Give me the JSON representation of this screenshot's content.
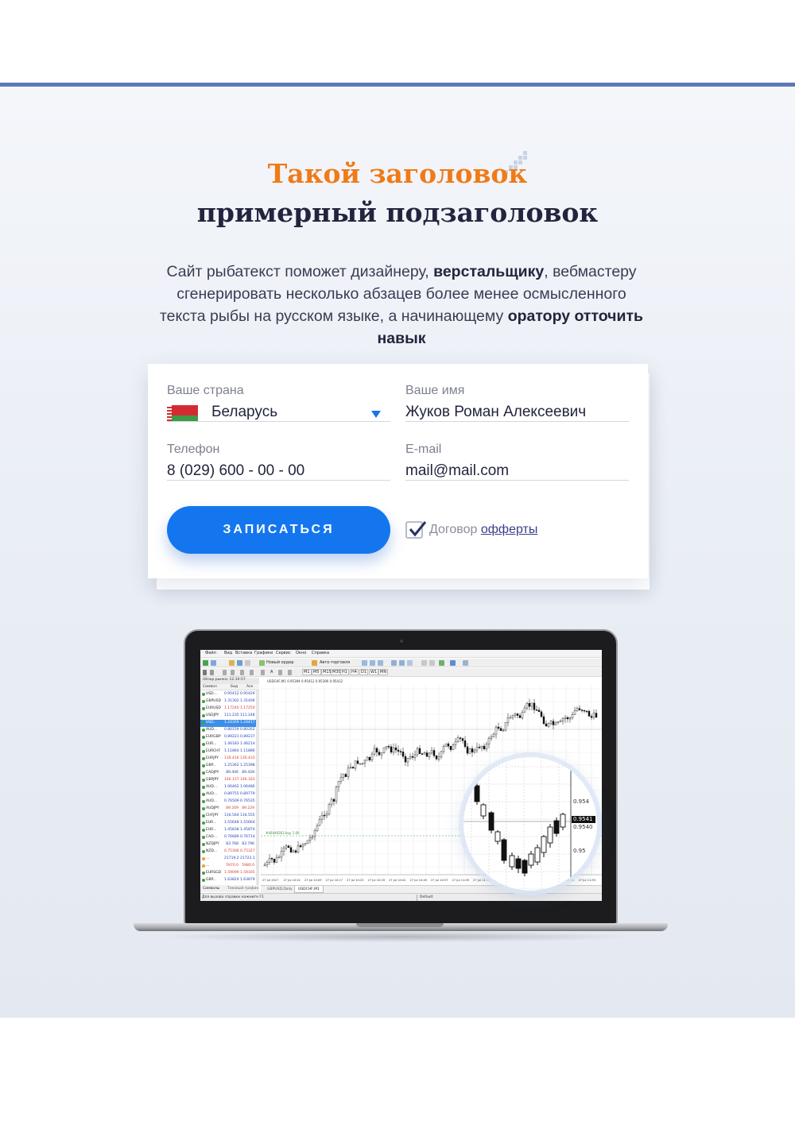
{
  "colors": {
    "accent": "#1476ee",
    "title_orange": "#f07a18",
    "title_dark": "#22253d",
    "top_line": "#5a78b4"
  },
  "hero": {
    "title": "Такой заголовок",
    "subtitle": "примерный подзаголовок",
    "lead_1": "Сайт рыбатекст поможет дизайнеру, ",
    "lead_b1": "верстальщику",
    "lead_2": ", вебмастеру сгенерировать несколько абзацев более менее осмысленного текста рыбы на русском языке, а начинающему ",
    "lead_b2": "оратору отточить навык"
  },
  "form": {
    "country_label": "Ваше страна",
    "country_value": "Беларусь",
    "country_flag": "belarus-flag",
    "name_label": "Ваше имя",
    "name_value": "Жуков Роман Алексеевич",
    "phone_label": "Телефон",
    "phone_value": "8 (029) 600 - 00 - 00",
    "email_label": "E-mail",
    "email_value": "mail@mail.com",
    "submit_label": "ЗАПИСАТЬСЯ",
    "agree_text": "Договор ",
    "agree_link": "офферты",
    "agree_checked": true
  },
  "terminal": {
    "menu": [
      "Файл",
      "Вид",
      "Вставка",
      "Графики",
      "Сервис",
      "Окно",
      "Справка"
    ],
    "toolbar": [
      "Новый ордер",
      "Авто-торговля"
    ],
    "timeframes": [
      "M1",
      "M5",
      "M15",
      "M30",
      "H1",
      "H4",
      "D1",
      "W1",
      "MN"
    ],
    "market_watch_title": "Обзор рынка: 12:10:57",
    "columns": [
      "Символ",
      "Бид",
      "Аск"
    ],
    "rows": [
      {
        "symbol": "USD...",
        "bid": "0.95412",
        "ask": "0.95429"
      },
      {
        "symbol": "GBPUSD",
        "bid": "1.31302",
        "ask": "1.31406"
      },
      {
        "symbol": "EURUSD",
        "bid": "1.17240",
        "ask": "1.17250"
      },
      {
        "symbol": "USDJPY",
        "bid": "111.235",
        "ask": "111.248"
      },
      {
        "symbol": "USD...",
        "bid": "1.24359",
        "ask": "1.24417"
      },
      {
        "symbol": "AUD...",
        "bid": "0.80159",
        "ask": "0.80262"
      },
      {
        "symbol": "EURGBP",
        "bid": "0.89221",
        "ask": "0.89237"
      },
      {
        "symbol": "EUR...",
        "bid": "1.46183",
        "ask": "1.46214"
      },
      {
        "symbol": "EURCHF",
        "bid": "1.11864",
        "ask": "1.11886"
      },
      {
        "symbol": "EURJPY",
        "bid": "130.416",
        "ask": "130.433"
      },
      {
        "symbol": "GBP...",
        "bid": "1.25362",
        "ask": "1.25398"
      },
      {
        "symbol": "CADJPY",
        "bid": "89.406",
        "ask": "89.428"
      },
      {
        "symbol": "GBPJPY",
        "bid": "146.157",
        "ask": "146.183"
      },
      {
        "symbol": "AUD...",
        "bid": "1.06462",
        "ask": "1.06486"
      },
      {
        "symbol": "AUD...",
        "bid": "0.89755",
        "ask": "0.89779"
      },
      {
        "symbol": "AUD...",
        "bid": "0.76509",
        "ask": "0.76535"
      },
      {
        "symbol": "AUDJPY",
        "bid": "89.209",
        "ask": "89.229"
      },
      {
        "symbol": "CHFJPY",
        "bid": "116.564",
        "ask": "116.555"
      },
      {
        "symbol": "EUR...",
        "bid": "1.55648",
        "ask": "1.55664"
      },
      {
        "symbol": "EUR...",
        "bid": "1.45838",
        "ask": "1.45874"
      },
      {
        "symbol": "CAD...",
        "bid": "0.76689",
        "ask": "0.76714"
      },
      {
        "symbol": "NZDJPY",
        "bid": "83.768",
        "ask": "83.796"
      },
      {
        "symbol": "NZD...",
        "bid": "0.75306",
        "ask": "0.75327"
      },
      {
        "symbol": "...",
        "bid": "21719.2",
        "ask": "21723.1"
      },
      {
        "symbol": "...",
        "bid": "5970.0",
        "ask": "5980.0"
      },
      {
        "symbol": "EURSGD",
        "bid": "1.59099",
        "ask": "1.59165"
      },
      {
        "symbol": "GBP...",
        "bid": "1.63824",
        "ask": "1.63879"
      }
    ],
    "side_tabs": [
      "Символы",
      "Тиковый график"
    ],
    "chart_header": "USDCHF,M1  0.95394 0.95412 0.95390 0.95412",
    "order_label": "#40449263 buy 1.00",
    "chart_tabs": [
      "GBPUSD,Daily",
      "USDCHF,M1"
    ],
    "status_left": "Для вызова справки нажмите F1",
    "status_right": "Default",
    "time_labels": [
      "27 Jul 2017",
      "27 Jul 10:01",
      "27 Jul 10:09",
      "27 Jul 10:17",
      "27 Jul 10:25",
      "27 Jul 10:33",
      "27 Jul 10:41",
      "27 Jul 10:49",
      "27 Jul 10:57",
      "27 Jul 11:05",
      "27 Jul 11:13",
      "27 Jul 11:21",
      "27 Jul 11:29",
      "27 Jul 11:37",
      "27 Jul 11:45",
      "27 Jul 11:53"
    ],
    "magnifier_prices": [
      "0.954",
      "0.9541",
      "0.9540",
      "0.95"
    ]
  }
}
